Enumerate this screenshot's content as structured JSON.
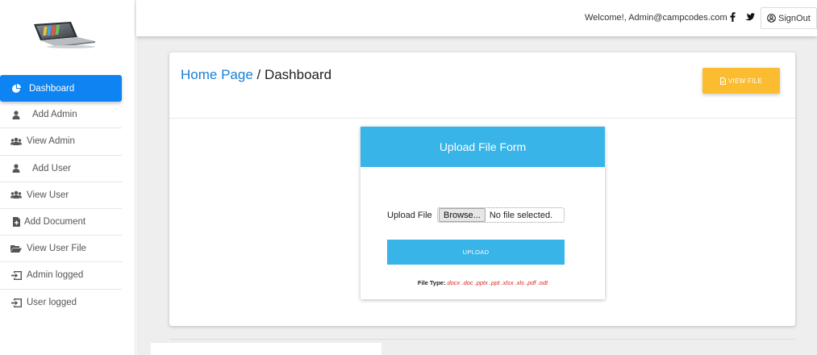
{
  "sidebar": {
    "logo": "laptop-logo-icon",
    "items": [
      {
        "label": "Dashboard",
        "icon": "pie-chart-icon",
        "active": true
      },
      {
        "label": "Add Admin",
        "icon": "user-icon"
      },
      {
        "label": "View Admin",
        "icon": "users-icon"
      },
      {
        "label": "Add User",
        "icon": "user-icon"
      },
      {
        "label": "View User",
        "icon": "users-icon"
      },
      {
        "label": "Add Document",
        "icon": "file-add-icon"
      },
      {
        "label": "View User File",
        "icon": "folder-open-icon"
      },
      {
        "label": "Admin logged",
        "icon": "sign-in-icon"
      },
      {
        "label": "User logged",
        "icon": "sign-in-icon"
      }
    ]
  },
  "header": {
    "welcome": "Welcome!, Admin@campcodes.com",
    "signout_label": "SignOut"
  },
  "breadcrumb": {
    "home": "Home Page",
    "separator": " / ",
    "current": "Dashboard"
  },
  "view_file_label": "VIEW FILE",
  "upload_form": {
    "title": "Upload File Form",
    "field_label": "Upload File",
    "browse_label": "Browse...",
    "file_status": "No file selected.",
    "upload_label": "UPLOAD",
    "file_type_label": "File Type:",
    "file_types": ".docx .doc .pptx .ppt .xlsx .xls .pdf .odt"
  },
  "colors": {
    "active_nav": "#0d84f2",
    "header_blue": "#38b4e8",
    "view_file_btn": "#fbbc30",
    "link_blue": "#1a7fd6",
    "file_types_red": "#d9261c"
  }
}
